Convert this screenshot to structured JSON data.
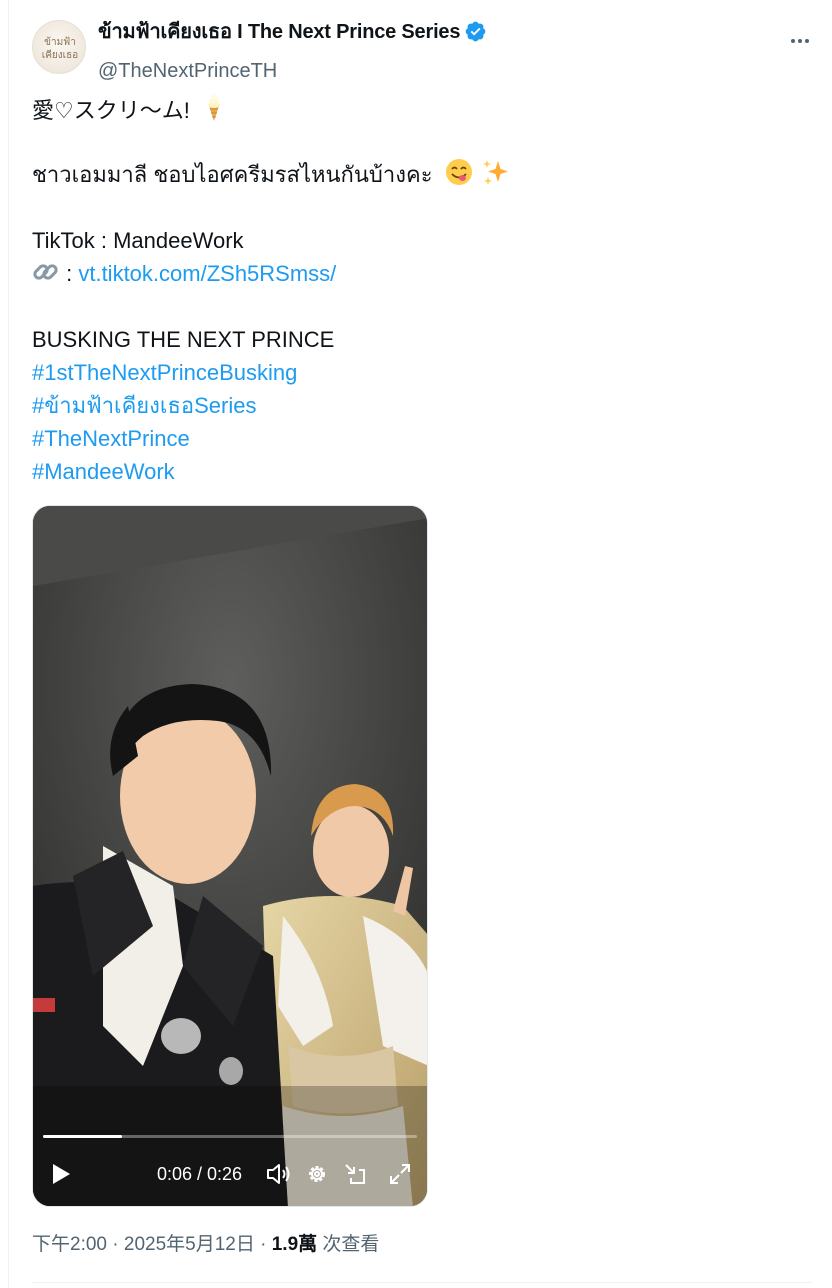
{
  "tweet": {
    "author": {
      "display_name": "ข้ามฟ้าเคียงเธอ I The Next Prince Series",
      "handle": "@TheNextPrinceTH",
      "verified": true,
      "avatar_logo_text": [
        "ข้ามฟ้า",
        "เคียงเธอ"
      ]
    },
    "more_icon": "more-horizontal-icon",
    "lines": [
      {
        "text": "愛♡スクリ～ム! ",
        "emoji": "soft-ice-cream-emoji"
      },
      {
        "text": ""
      },
      {
        "text": "ชาวเอมมาลี ชอบไอศครีมรสไหนกันบ้างคะ ",
        "emoji": "yum-face-emoji",
        "emoji2": "sparkles-emoji"
      },
      {
        "text": ""
      },
      {
        "text": "TikTok : MandeeWork"
      },
      {
        "prefix": " : ",
        "link": "vt.tiktok.com/ZSh5RSmss/",
        "emoji": "link-emoji"
      },
      {
        "text": ""
      },
      {
        "text": "BUSKING THE NEXT PRINCE"
      },
      {
        "hashtag": "#1stTheNextPrinceBusking"
      },
      {
        "hashtag": "#ข้ามฟ้าเคียงเธอSeries"
      },
      {
        "hashtag": "#TheNextPrince"
      },
      {
        "hashtag": "#MandeeWork"
      }
    ],
    "video": {
      "current_time": "0:06",
      "duration": "0:26",
      "time_display": "0:06 / 0:26",
      "progress": 0.21,
      "controls": [
        "play-icon",
        "volume-icon",
        "settings-icon",
        "pop-out-icon",
        "fullscreen-icon"
      ]
    },
    "meta": {
      "time": "下午2:00",
      "separator": " · ",
      "date": "2025年5月12日",
      "views_count": "1.9萬",
      "views_label": " 次查看"
    }
  },
  "colors": {
    "link": "#1d9bf0",
    "text": "#0f1419",
    "secondary": "#536471",
    "verified": "#1d9bf0"
  }
}
